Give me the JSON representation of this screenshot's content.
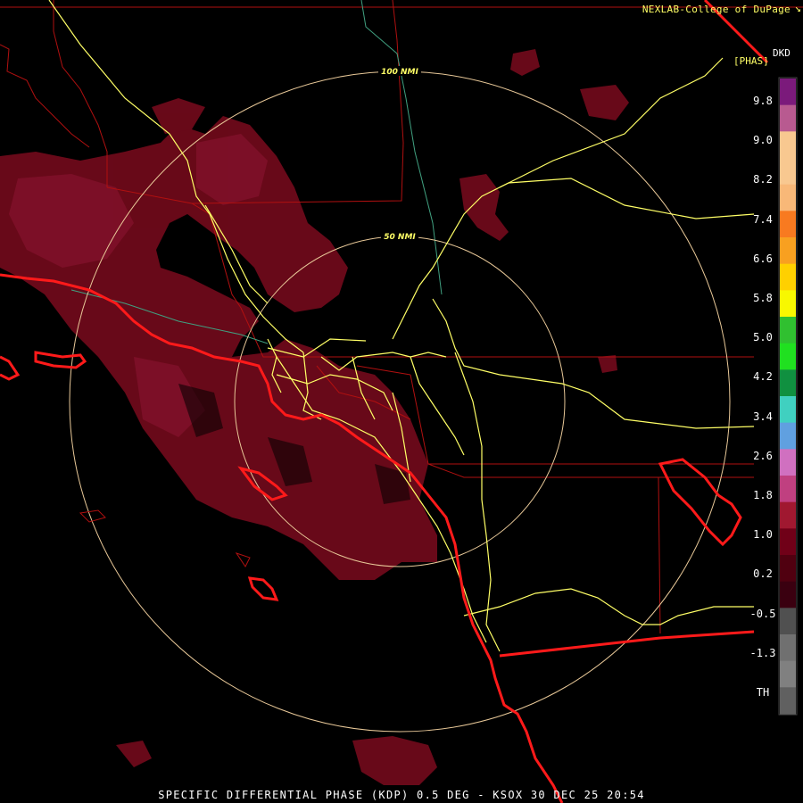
{
  "header": {
    "credit": "NEXLAB-College of DuPage",
    "credit_icon": "diagonal-arrow-icon",
    "product_code": "DKD",
    "units": "[PHAS]"
  },
  "rings": [
    {
      "label": "100 NMI"
    },
    {
      "label": "50 NMI"
    }
  ],
  "colorbar": {
    "labels": [
      "9.8",
      "9.0",
      "8.2",
      "7.4",
      "6.6",
      "5.8",
      "5.0",
      "4.2",
      "3.4",
      "2.6",
      "1.8",
      "1.0",
      "0.2",
      "-0.5",
      "-1.3",
      "TH"
    ],
    "colors": [
      "#7b1a7b",
      "#b85a90",
      "#f8c890",
      "#f8c890",
      "#f8b878",
      "#f87a20",
      "#f8a020",
      "#ffd000",
      "#f8f800",
      "#30c030",
      "#20e020",
      "#109040",
      "#40d0c0",
      "#60a0e0",
      "#d070c0",
      "#c04080",
      "#a01830",
      "#700018",
      "#500010",
      "#3a0010",
      "#505050",
      "#707070",
      "#808080",
      "#606060"
    ]
  },
  "footer": {
    "title": "SPECIFIC DIFFERENTIAL PHASE (KDP) 0.5 DEG - KSOX 30 DEC 25 20:54"
  },
  "colors": {
    "echo": "#6e0a1a",
    "echo_dark": "#4a0610",
    "county": "#b01010",
    "state": "#ff1a1a",
    "highway": "#ffff66",
    "ring": "#e8c898",
    "river": "#40a080"
  }
}
